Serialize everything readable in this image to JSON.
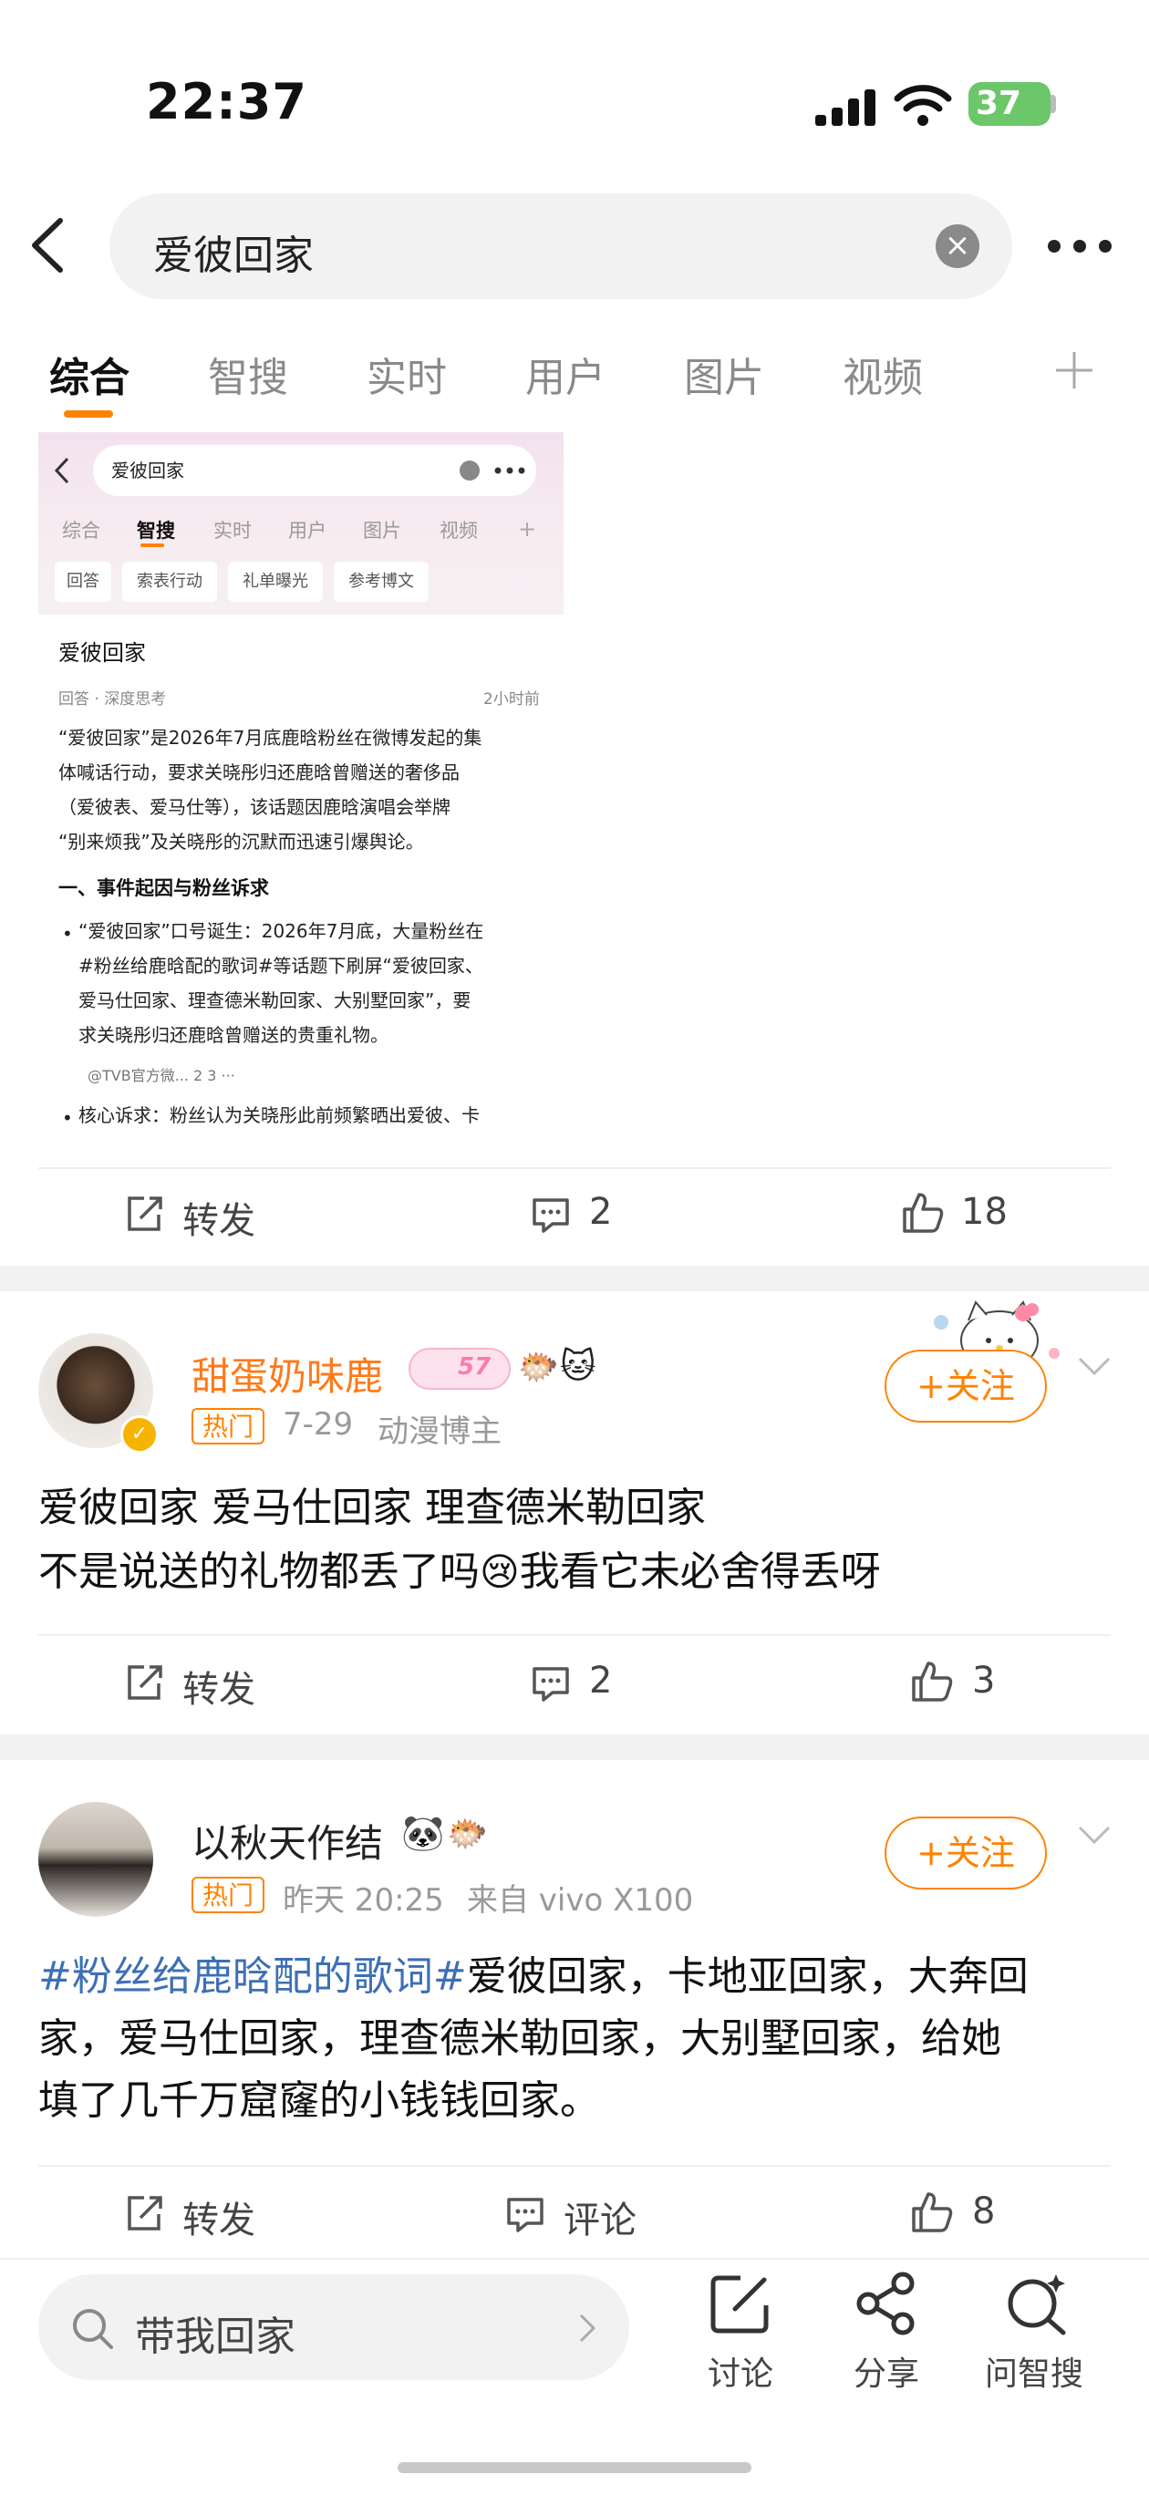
{
  "status": {
    "time": "22:37",
    "battery": "37"
  },
  "search": {
    "query": "爱彼回家"
  },
  "tabs": [
    {
      "label": "综合"
    },
    {
      "label": "智搜"
    },
    {
      "label": "实时"
    },
    {
      "label": "用户"
    },
    {
      "label": "图片"
    },
    {
      "label": "视频"
    }
  ],
  "shot": {
    "query": "爱彼回家",
    "tabs": [
      "综合",
      "智搜",
      "实时",
      "用户",
      "图片",
      "视频"
    ],
    "chips": [
      "回答",
      "索表行动",
      "礼单曝光",
      "参考博文"
    ],
    "title": "爱彼回家",
    "meta": "回答 · 深度思考",
    "time": "2小时前",
    "p1_l1": "“爱彼回家”是2026年7月底鹿晗粉丝在微博发起的集",
    "p1_l2": "体喊话行动，要求关晓彤归还鹿晗曾赠送的奢侈品",
    "p1_l3": "（爱彼表、爱马仕等），该话题因鹿晗演唱会举牌",
    "p1_l4": "“别来烦我”及关晓彤的沉默而迅速引爆舆论。",
    "h2": "一、事件起因与粉丝诉求",
    "b1_l1": "“爱彼回家”口号诞生：2026年7月底，大量粉丝在",
    "b1_l2": "#粉丝给鹿晗配的歌词#等话题下刷屏“爱彼回家、",
    "b1_l3": "爱马仕回家、理查德米勒回家、大别墅回家”，要",
    "b1_l4": "求关晓彤归还鹿晗曾赠送的贵重礼物。",
    "cite": "@TVB官方微...   2   3   ···",
    "b2": "核心诉求：粉丝认为关晓彤此前频繁晒出爱彼、卡"
  },
  "post0_actions": {
    "repost": "转发",
    "comments": "2",
    "likes": "18"
  },
  "post1": {
    "username": "甜蛋奶味鹿",
    "badge_level": "57",
    "hot": "热门",
    "date": "7-29",
    "role": "动漫博主",
    "follow": "+关注",
    "line1": "爱彼回家 爱马仕回家 理查德米勒回家",
    "line2a": "不是说送的礼物都丢了吗",
    "line2b": "我看它未必舍得丢呀",
    "actions": {
      "repost": "转发",
      "comments": "2",
      "likes": "3"
    }
  },
  "post2": {
    "username": "以秋天作结",
    "hot": "热门",
    "time": "昨天 20:25",
    "source": "来自 vivo X100",
    "follow": "+关注",
    "topic": "#粉丝给鹿晗配的歌词#",
    "text1": "爱彼回家，卡地亚回家，大奔回",
    "text2": "家，爱马仕回家，理查德米勒回家，大别墅回家，给她",
    "text3": "填了几千万窟窿的小钱钱回家。",
    "actions": {
      "repost": "转发",
      "comment": "评论",
      "likes": "8"
    }
  },
  "bottom": {
    "search_placeholder": "带我回家",
    "discuss": "讨论",
    "share": "分享",
    "ask": "问智搜"
  },
  "colors": {
    "accent": "#ff8200",
    "topic": "#3d6fb6",
    "battery": "#6cc76a"
  }
}
